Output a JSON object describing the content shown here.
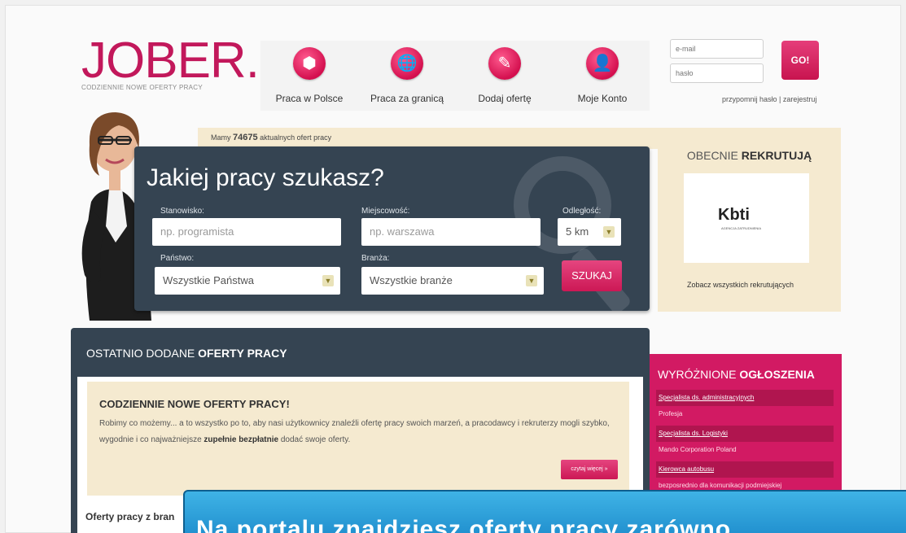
{
  "logo": {
    "text": "JOBER.PL",
    "tagline": "CODZIENNIE NOWE OFERTY PRACY"
  },
  "nav": [
    {
      "label": "Praca w Polsce",
      "icon": "poland-map-icon",
      "glyph": "⬢"
    },
    {
      "label": "Praca za granicą",
      "icon": "globe-icon",
      "glyph": "🌐"
    },
    {
      "label": "Dodaj ofertę",
      "icon": "document-edit-icon",
      "glyph": "✎"
    },
    {
      "label": "Moje Konto",
      "icon": "user-icon",
      "glyph": "👤"
    }
  ],
  "login": {
    "email_placeholder": "e-mail",
    "password_placeholder": "hasło",
    "go_label": "GO!",
    "links": "przypomnij hasło | zarejestruj"
  },
  "count": {
    "prefix": "Mamy",
    "number": "74675",
    "suffix": "aktualnych ofert pracy"
  },
  "search": {
    "title": "Jakiej pracy szukasz?",
    "position_label": "Stanowisko:",
    "position_placeholder": "np. programista",
    "city_label": "Miejscowość:",
    "city_placeholder": "np. warszawa",
    "distance_label": "Odległość:",
    "distance_value": "5 km",
    "country_label": "Państwo:",
    "country_value": "Wszystkie Państwa",
    "industry_label": "Branża:",
    "industry_value": "Wszystkie branże",
    "submit_label": "SZUKAJ"
  },
  "recruit": {
    "title_light": "OBECNIE",
    "title_bold": "REKRUTUJĄ",
    "company_logo": "Kbti",
    "company_sub": "AGENCJA ZATRUDNIENIA",
    "see_all": "Zobacz wszystkich rekrutujących"
  },
  "latest": {
    "title_light": "OSTATNIO DODANE",
    "title_bold": "OFERTY PRACY",
    "promo_head": "CODZIENNIE NOWE OFERTY PRACY!",
    "promo_text_1": "Robimy co możemy... a to wszystko po to, aby nasi użytkownicy znaleźli ofertę pracy swoich marzeń, a pracodawcy i rekruterzy mogli szybko, wygodnie i co najważniejsze",
    "promo_text_bold": "zupełnie bezpłatnie",
    "promo_text_2": "dodać swoje oferty.",
    "read_more": "czytaj więcej »",
    "offers_by": "Oferty pracy z branż"
  },
  "featured": {
    "title_light": "WYRÓŻNIONE",
    "title_bold": "OGŁOSZENIA",
    "items": [
      {
        "title": "Specjalista ds. administracyjnych",
        "company": "Profesja"
      },
      {
        "title": "Specjalista ds. Logistyki",
        "company": "Mando Corporation Poland"
      },
      {
        "title": "Kierowca autobusu",
        "company": "bezposrednio dla komunikacji podmiejskiej"
      }
    ]
  },
  "banner": {
    "text": "Na portalu znajdziesz oferty pracy zarówno"
  },
  "colors": {
    "brand": "#c2185b",
    "panel": "#354452",
    "cream": "#f5ead0",
    "featured": "#d21a63"
  }
}
